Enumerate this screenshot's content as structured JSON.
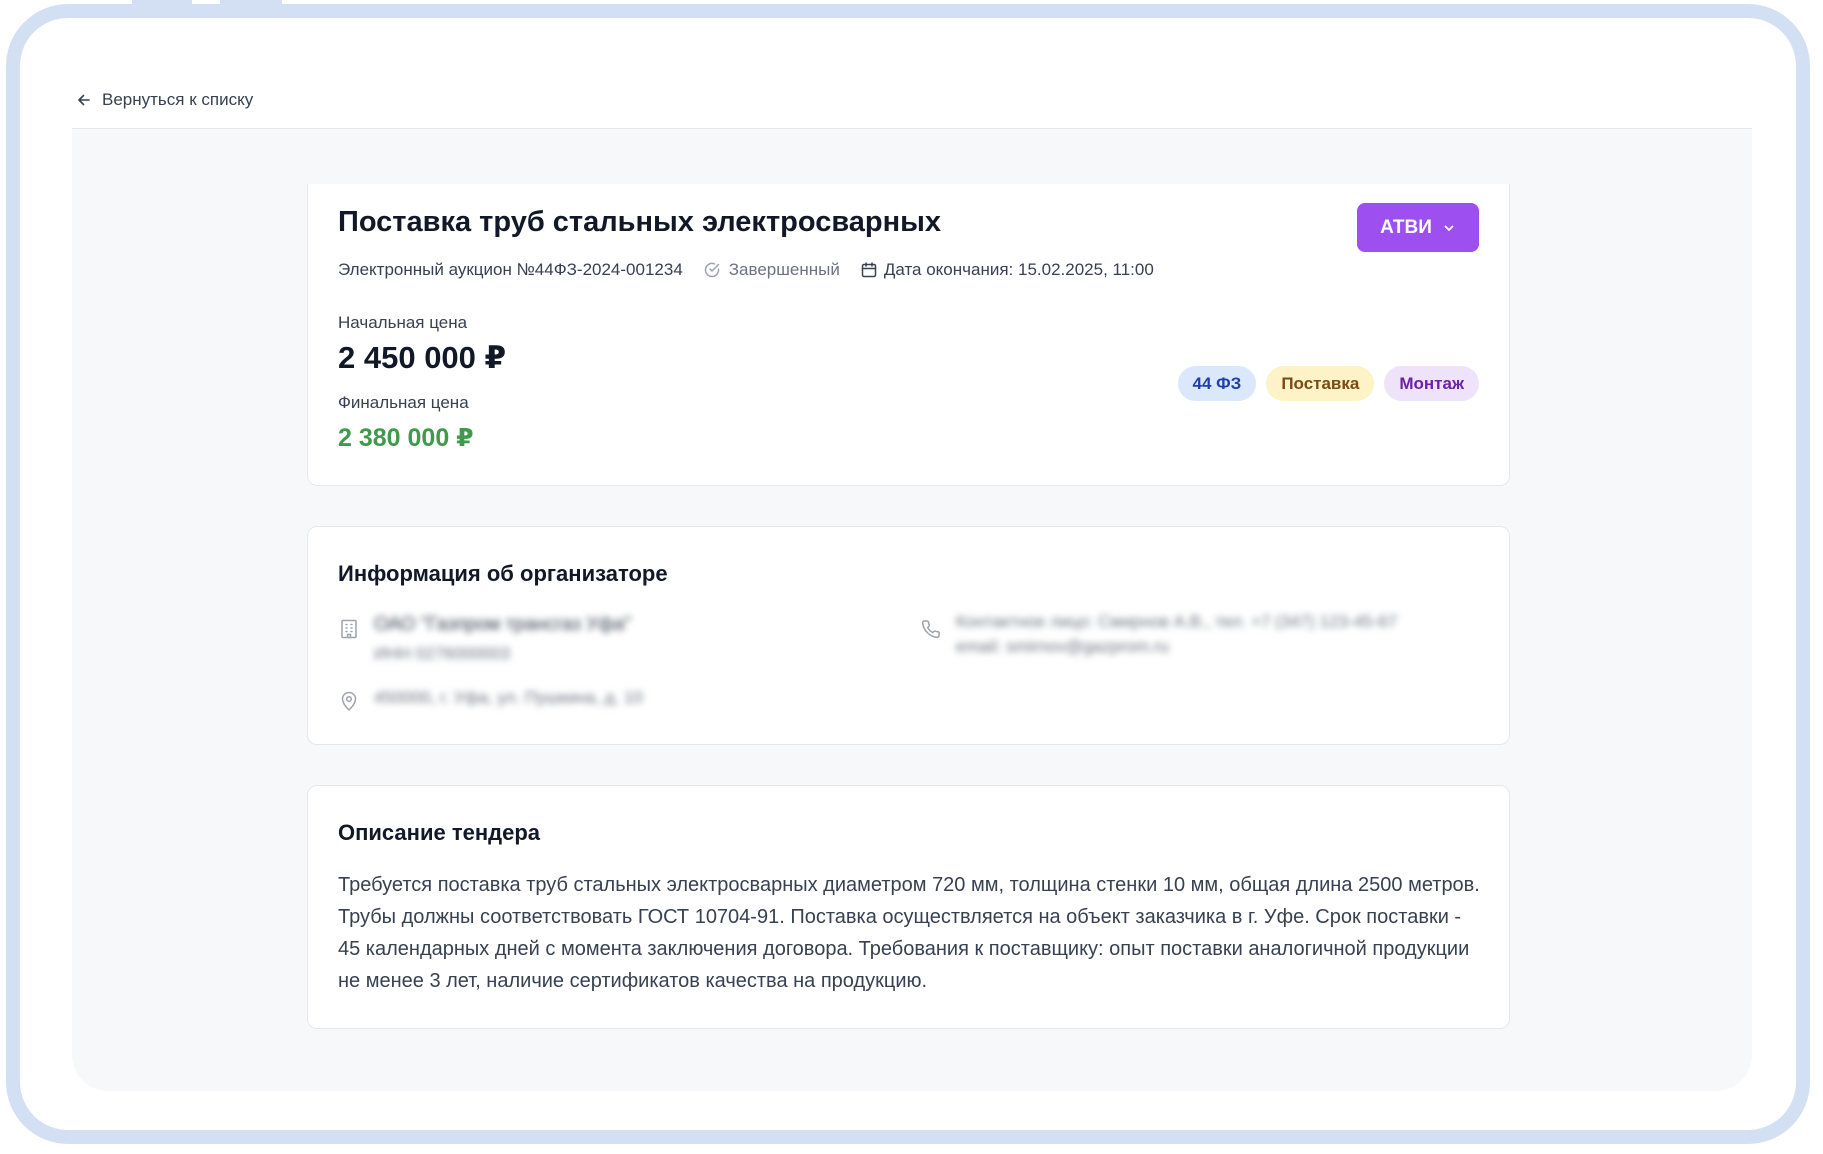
{
  "back_link": {
    "label": "Вернуться к списку"
  },
  "tender": {
    "title": "Поставка труб стальных электросварных",
    "procedure": "Электронный аукцион №44ФЗ-2024-001234",
    "status": "Завершенный",
    "end_date": "Дата окончания: 15.02.2025, 11:00",
    "owner_button": "АТВИ",
    "start_price_label": "Начальная цена",
    "start_price": "2 450 000 ₽",
    "final_price_label": "Финальная цена",
    "final_price": "2 380 000 ₽",
    "tags": [
      {
        "label": "44 ФЗ",
        "bg": "#dbe7fb",
        "color": "#1e40af"
      },
      {
        "label": "Поставка",
        "bg": "#fdf3c7",
        "color": "#7c4a12"
      },
      {
        "label": "Монтаж",
        "bg": "#efe3fb",
        "color": "#6b21a8"
      }
    ]
  },
  "organizer": {
    "title": "Информация об организаторе",
    "name": "ОАО \"Газпром трансгаз Уфа\"",
    "inn": "ИНН 0276000003",
    "address": "450000, г. Уфа, ул. Пушкина, д. 10",
    "contact": "Контактное лицо: Смирнов А.В., тел. +7 (347) 123-45-67",
    "email": "email: smirnov@gazprom.ru"
  },
  "description": {
    "title": "Описание тендера",
    "text": "Требуется поставка труб стальных электросварных диаметром 720 мм, толщина стенки 10 мм, общая длина 2500 метров. Трубы должны соответствовать ГОСТ 10704-91. Поставка осуществляется на объект заказчика в г. Уфе. Срок поставки - 45 календарных дней с момента заключения договора. Требования к поставщику: опыт поставки аналогичной продукции не менее 3 лет, наличие сертификатов качества на продукцию."
  },
  "colors": {
    "accent": "#9d4ff0",
    "final_price": "#3f9a4c",
    "frame": "#d3e0f4"
  }
}
